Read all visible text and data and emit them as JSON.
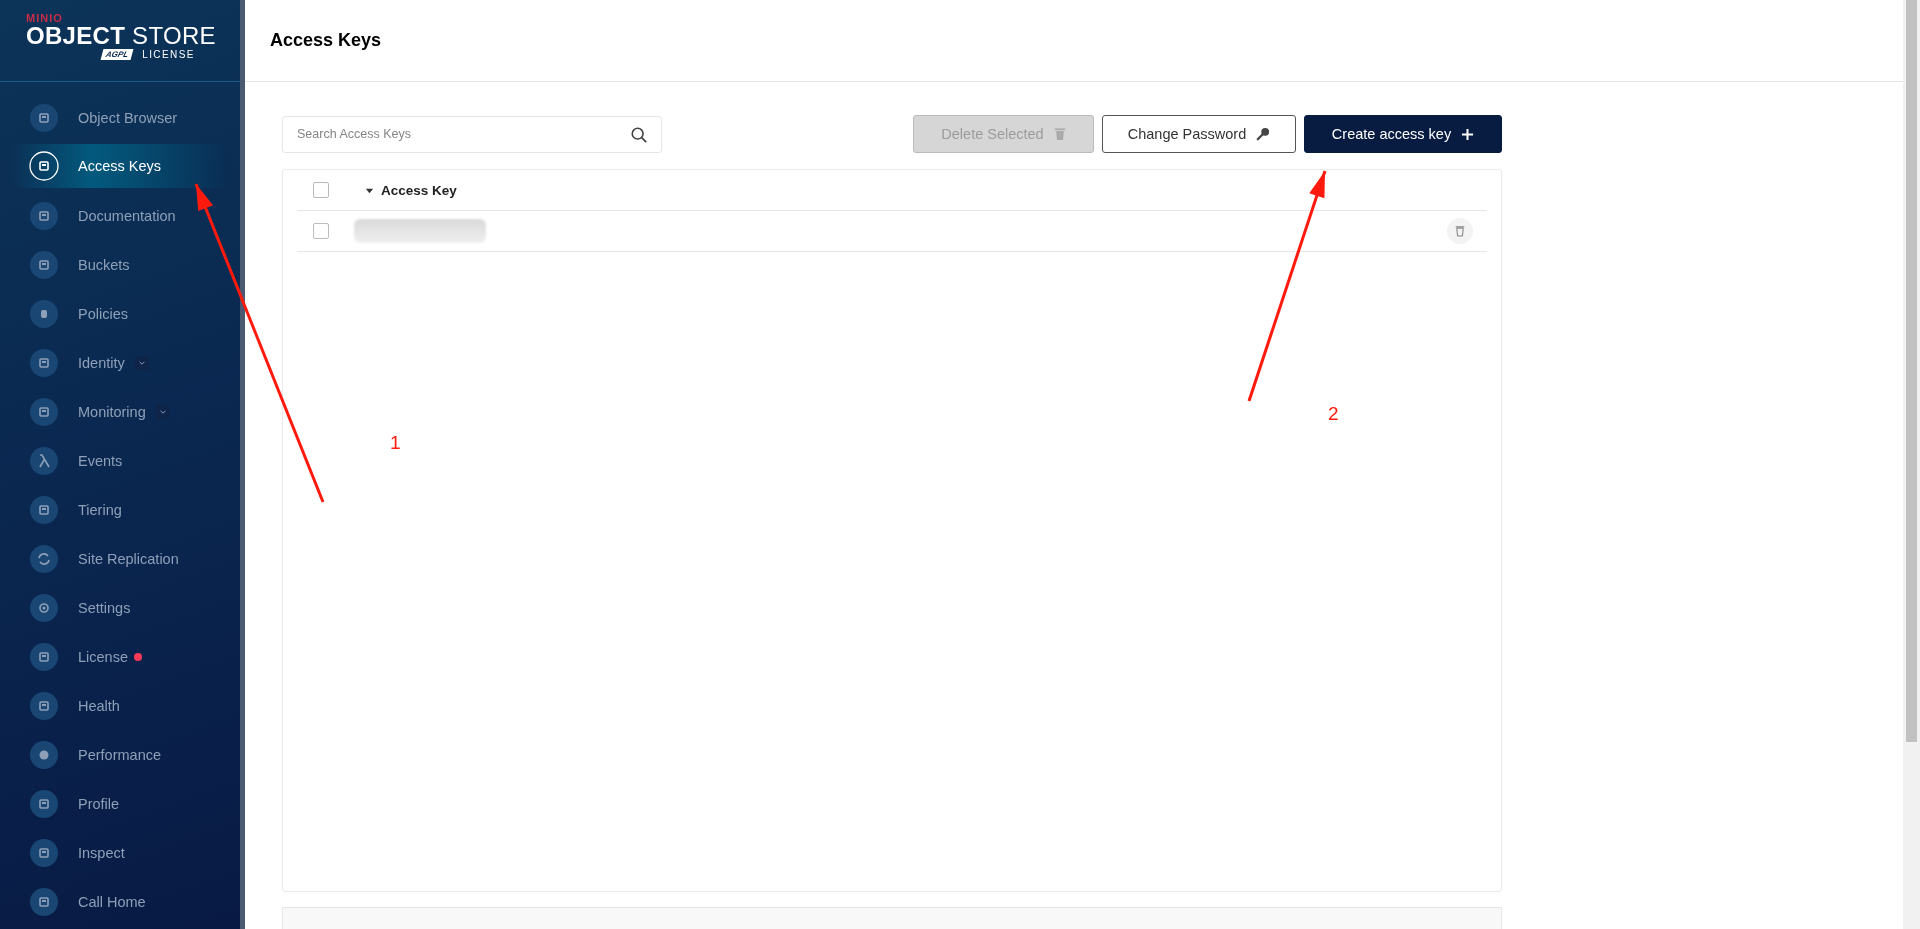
{
  "logo": {
    "brand": "MINIO",
    "product_bold": "OBJECT",
    "product": "STORE",
    "license_badge": "AGPL",
    "license": "LICENSE"
  },
  "sidebar": {
    "items": [
      {
        "label": "Object Browser",
        "selected": false
      },
      {
        "label": "Access Keys",
        "selected": true
      },
      {
        "label": "Documentation",
        "selected": false
      },
      {
        "label": "Buckets",
        "selected": false
      },
      {
        "label": "Policies",
        "selected": false
      },
      {
        "label": "Identity",
        "selected": false,
        "expandable": true
      },
      {
        "label": "Monitoring",
        "selected": false,
        "expandable": true
      },
      {
        "label": "Events",
        "selected": false
      },
      {
        "label": "Tiering",
        "selected": false
      },
      {
        "label": "Site Replication",
        "selected": false
      },
      {
        "label": "Settings",
        "selected": false
      },
      {
        "label": "License",
        "selected": false,
        "badge": true
      },
      {
        "label": "Health",
        "selected": false
      },
      {
        "label": "Performance",
        "selected": false
      },
      {
        "label": "Profile",
        "selected": false
      },
      {
        "label": "Inspect",
        "selected": false
      },
      {
        "label": "Call Home",
        "selected": false
      }
    ]
  },
  "page_title": "Access Keys",
  "search": {
    "placeholder": "Search Access Keys"
  },
  "buttons": [
    {
      "label": "Delete Selected",
      "kind": "delete",
      "disabled": true
    },
    {
      "label": "Change Password",
      "kind": "password",
      "disabled": false
    },
    {
      "label": "Create access key",
      "kind": "create",
      "disabled": false
    }
  ],
  "table": {
    "columns": [
      {
        "label": "Access Key",
        "sorted": true
      }
    ],
    "select_all_checked": false,
    "rows": [
      {
        "checked": false,
        "redacted": true
      }
    ]
  },
  "annotations": [
    {
      "label": "1"
    },
    {
      "label": "2"
    }
  ]
}
